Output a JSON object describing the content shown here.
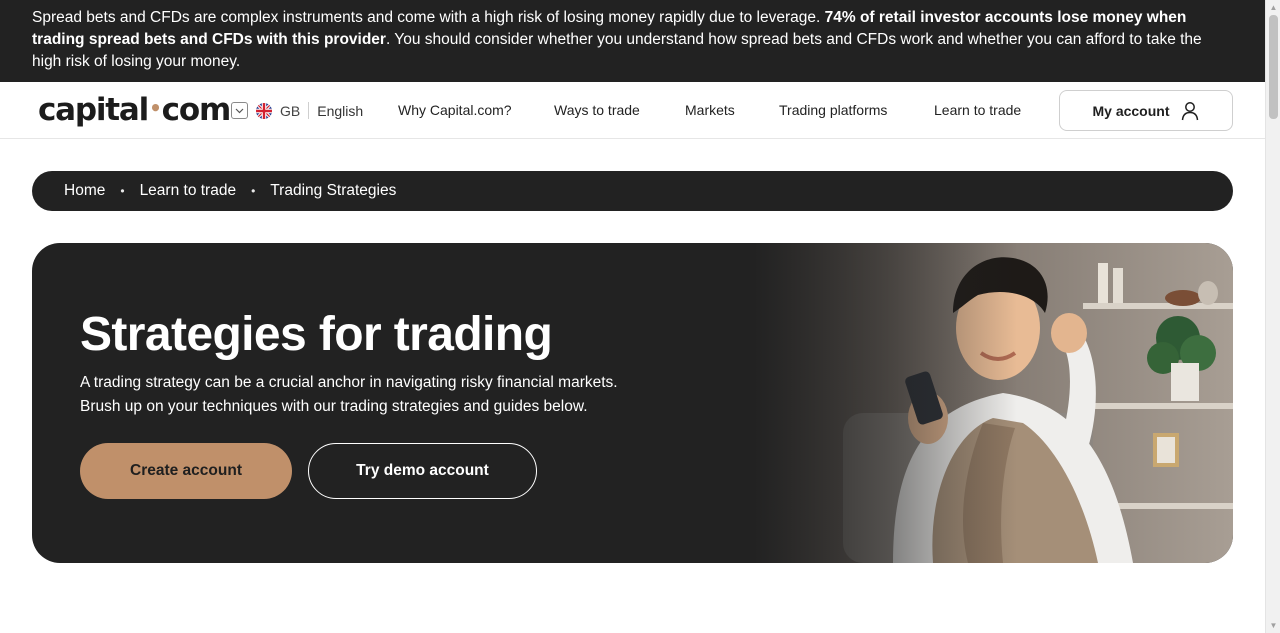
{
  "risk_banner": {
    "text_start": "Spread bets and CFDs are complex instruments and come with a high risk of losing money rapidly due to leverage. ",
    "text_bold": "74% of retail investor accounts lose money when trading spread bets and CFDs with this provider",
    "text_end": ". You should consider whether you understand how spread bets and CFDs work and whether you can afford to take the high risk of losing your money."
  },
  "header": {
    "logo_left": "capital",
    "logo_dot": "•",
    "logo_right": "com",
    "locale": {
      "country": "GB",
      "language": "English"
    },
    "nav": [
      "Why Capital.com?",
      "Ways to trade",
      "Markets",
      "Trading platforms",
      "Learn to trade"
    ],
    "account_label": "My account"
  },
  "breadcrumb": [
    "Home",
    "Learn to trade",
    "Trading Strategies"
  ],
  "hero": {
    "title": "Strategies for trading",
    "description_line1": "A trading strategy can be a crucial anchor in navigating risky financial markets.",
    "description_line2": "Brush up on your techniques with our trading strategies and guides below.",
    "primary_cta": "Create account",
    "secondary_cta": "Try demo account"
  },
  "colors": {
    "accent": "#c0906a",
    "dark": "#222222"
  }
}
